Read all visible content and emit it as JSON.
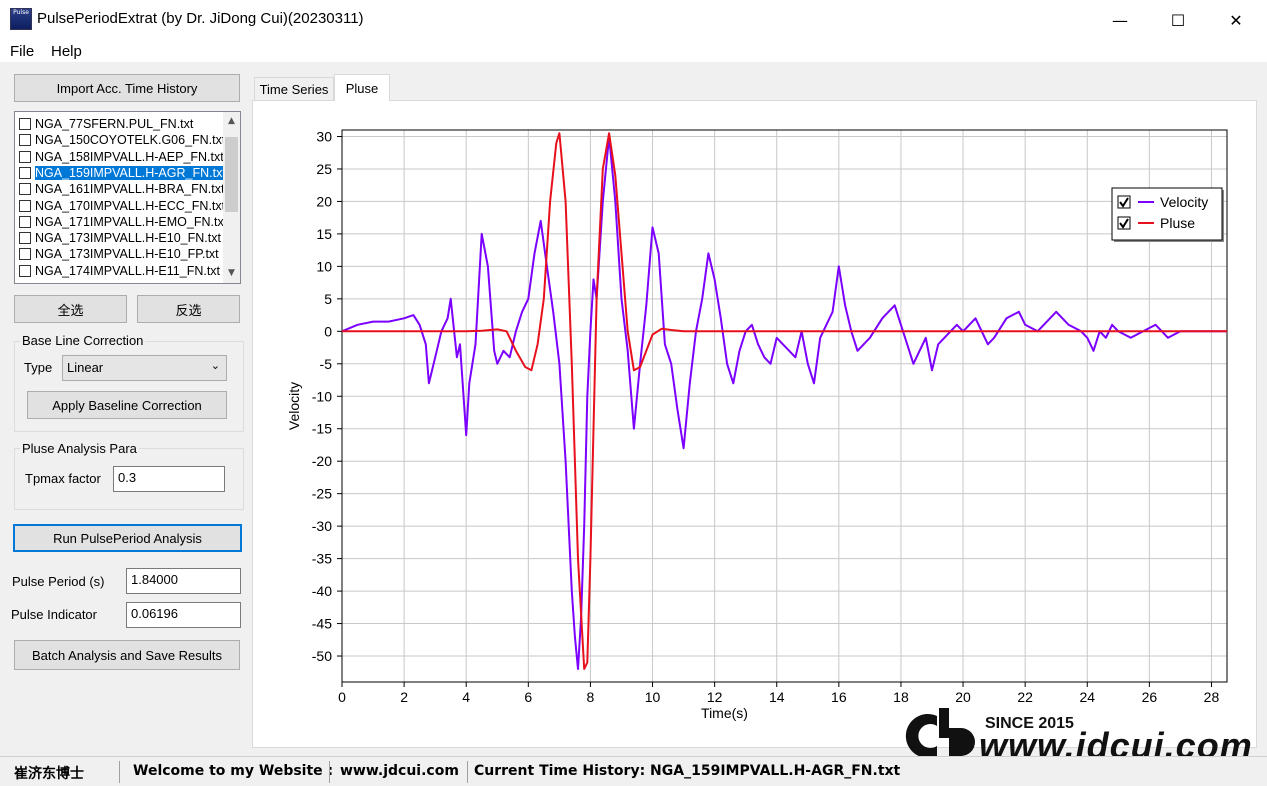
{
  "window": {
    "title": "PulsePeriodExtrat (by Dr. JiDong Cui)(20230311)",
    "icon_text": "Pulse",
    "minimize_glyph": "—",
    "maximize_glyph": "☐",
    "close_glyph": "✕"
  },
  "menu": {
    "file": "File",
    "help": "Help"
  },
  "left": {
    "import_button": "Import Acc. Time History",
    "files": [
      "NGA_77SFERN.PUL_FN.txt",
      "NGA_150COYOTELK.G06_FN.txt",
      "NGA_158IMPVALL.H-AEP_FN.txt",
      "NGA_159IMPVALL.H-AGR_FN.txt",
      "NGA_161IMPVALL.H-BRA_FN.txt",
      "NGA_170IMPVALL.H-ECC_FN.txt",
      "NGA_171IMPVALL.H-EMO_FN.txt",
      "NGA_173IMPVALL.H-E10_FN.txt",
      "NGA_173IMPVALL.H-E10_FP.txt",
      "NGA_174IMPVALL.H-E11_FN.txt"
    ],
    "selected_index": 3,
    "select_all": "全选",
    "invert_select": "反选",
    "baseline_group": "Base Line Correction",
    "type_label": "Type",
    "type_value": "Linear",
    "apply_baseline": "Apply Baseline Correction",
    "pulse_group": "Pluse Analysis Para",
    "tpmax_label": "Tpmax factor",
    "tpmax_value": "0.3",
    "run_button": "Run PulsePeriod Analysis",
    "pulse_period_label": "Pulse Period (s)",
    "pulse_period_value": "1.84000",
    "pulse_indicator_label": "Pulse Indicator",
    "pulse_indicator_value": "0.06196",
    "batch_button": "Batch Analysis and Save Results"
  },
  "tabs": {
    "time_series": "Time Series",
    "pluse": "Pluse",
    "active": "Pluse"
  },
  "chart_data": {
    "type": "line",
    "title": "",
    "xlabel": "Time(s)",
    "ylabel": "Velocity",
    "xlim": [
      0,
      28.5
    ],
    "ylim": [
      -54,
      31
    ],
    "x_ticks": [
      0,
      2,
      4,
      6,
      8,
      10,
      12,
      14,
      16,
      18,
      20,
      22,
      24,
      26,
      28
    ],
    "y_ticks": [
      30,
      25,
      20,
      15,
      10,
      5,
      0,
      -5,
      -10,
      -15,
      -20,
      -25,
      -30,
      -35,
      -40,
      -45,
      -50
    ],
    "grid": true,
    "legend_position": "top-right",
    "series": [
      {
        "name": "Velocity",
        "color": "#7b00ff",
        "x": [
          0,
          0.5,
          1.0,
          1.5,
          2.0,
          2.3,
          2.5,
          2.7,
          2.8,
          3.0,
          3.2,
          3.4,
          3.5,
          3.7,
          3.8,
          4.0,
          4.1,
          4.3,
          4.5,
          4.7,
          4.9,
          5.0,
          5.2,
          5.4,
          5.6,
          5.8,
          6.0,
          6.2,
          6.4,
          6.6,
          6.8,
          7.0,
          7.2,
          7.4,
          7.5,
          7.6,
          7.7,
          7.8,
          7.9,
          8.0,
          8.1,
          8.2,
          8.4,
          8.6,
          8.8,
          9.0,
          9.2,
          9.4,
          9.6,
          9.8,
          10.0,
          10.2,
          10.4,
          10.6,
          10.8,
          11.0,
          11.2,
          11.4,
          11.6,
          11.8,
          12.0,
          12.2,
          12.4,
          12.6,
          12.8,
          13.0,
          13.2,
          13.4,
          13.6,
          13.8,
          14.0,
          14.2,
          14.4,
          14.6,
          14.8,
          15.0,
          15.2,
          15.4,
          15.6,
          15.8,
          16.0,
          16.2,
          16.4,
          16.6,
          16.8,
          17.0,
          17.4,
          17.8,
          18.0,
          18.2,
          18.4,
          18.6,
          18.8,
          19.0,
          19.2,
          19.4,
          19.6,
          19.8,
          20.0,
          20.4,
          20.8,
          21.0,
          21.4,
          21.8,
          22.0,
          22.4,
          22.8,
          23.0,
          23.4,
          23.8,
          24.0,
          24.2,
          24.4,
          24.6,
          24.8,
          25.0,
          25.4,
          25.8,
          26.2,
          26.6,
          27.0,
          27.4,
          27.8,
          28.2,
          28.5
        ],
        "y": [
          0,
          1,
          1.5,
          1.5,
          2,
          2.5,
          1,
          -2,
          -8,
          -4,
          0,
          2,
          5,
          -4,
          -2,
          -16,
          -8,
          -2,
          15,
          10,
          -3,
          -5,
          -3,
          -4,
          0,
          3,
          5,
          12,
          17,
          10,
          3,
          -5,
          -20,
          -40,
          -47,
          -52,
          -44,
          -30,
          -10,
          0,
          8,
          5,
          20,
          30,
          20,
          5,
          -3,
          -15,
          -5,
          4,
          16,
          12,
          -2,
          -5,
          -12,
          -18,
          -8,
          0,
          5,
          12,
          8,
          2,
          -5,
          -8,
          -3,
          0,
          1,
          -2,
          -4,
          -5,
          -1,
          -2,
          -3,
          -4,
          0,
          -5,
          -8,
          -1,
          1,
          3,
          10,
          4,
          0,
          -3,
          -2,
          -1,
          2,
          4,
          1,
          -2,
          -5,
          -3,
          -1,
          -6,
          -2,
          -1,
          0,
          1,
          0,
          2,
          -2,
          -1,
          2,
          3,
          1,
          0,
          2,
          3,
          1,
          0,
          -1,
          -3,
          0,
          -1,
          1,
          0,
          -1,
          0,
          1,
          -1,
          0,
          0,
          0,
          0,
          0
        ]
      },
      {
        "name": "Pluse",
        "color": "#e8101c",
        "x": [
          0,
          1,
          2,
          3,
          4,
          4.5,
          5.0,
          5.3,
          5.6,
          5.9,
          6.1,
          6.3,
          6.5,
          6.7,
          6.9,
          7.0,
          7.2,
          7.4,
          7.6,
          7.8,
          7.9,
          8.0,
          8.2,
          8.4,
          8.6,
          8.8,
          9.0,
          9.2,
          9.4,
          9.6,
          9.8,
          10.0,
          10.3,
          10.6,
          11,
          12,
          14,
          16,
          18,
          20,
          22,
          24,
          26,
          28,
          28.5
        ],
        "y": [
          0,
          0,
          0,
          0,
          0,
          0.1,
          0.3,
          0,
          -3,
          -5.5,
          -6,
          -2,
          5,
          20,
          29,
          30.5,
          20,
          -5,
          -35,
          -52,
          -51,
          -35,
          5,
          25,
          30.5,
          24,
          12,
          0,
          -6,
          -5.5,
          -3,
          -0.5,
          0.4,
          0.2,
          0,
          0,
          0,
          0,
          0,
          0,
          0,
          0,
          0,
          0,
          0
        ]
      }
    ]
  },
  "status": {
    "name": "崔济东博士",
    "welcome": "Welcome to my Website :",
    "website": "www.jdcui.com",
    "current_label": "Current Time History: NGA_159IMPVALL.H-AGR_FN.txt"
  },
  "logo": {
    "since": "SINCE 2015",
    "url": "www.jdcui.com"
  }
}
